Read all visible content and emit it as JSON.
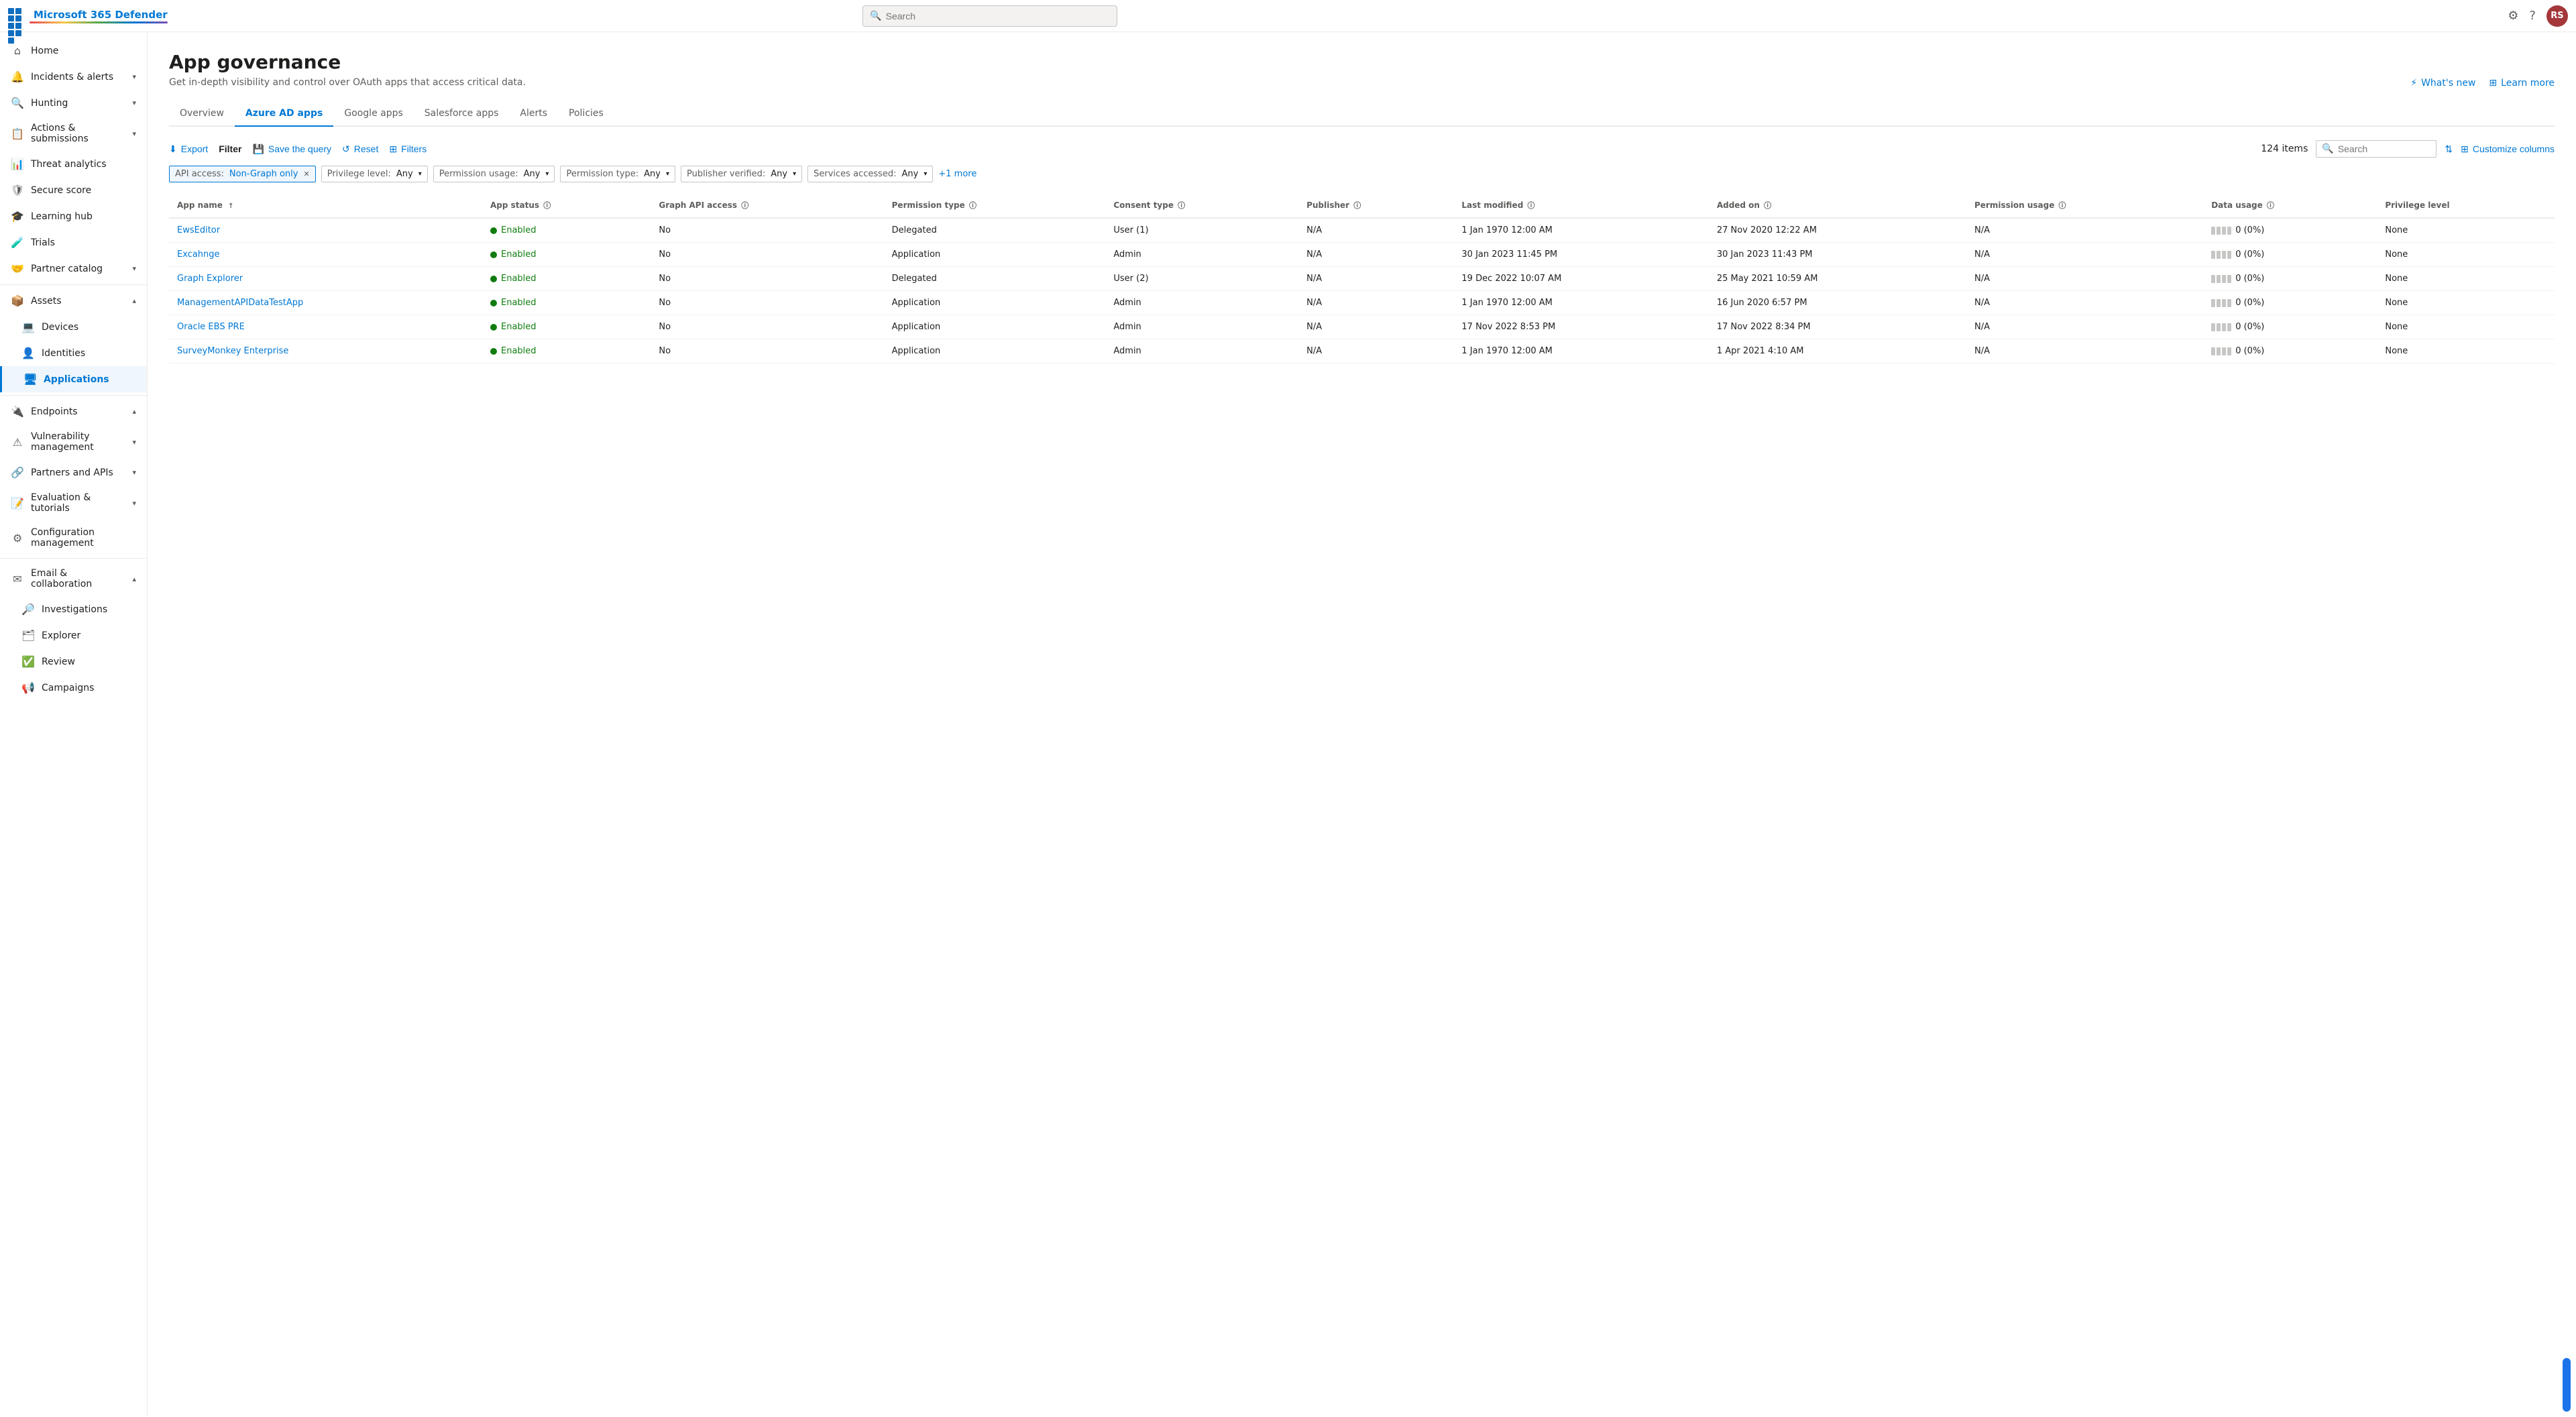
{
  "brand": {
    "name": "Microsoft 365 Defender",
    "search_placeholder": "Search"
  },
  "topbar": {
    "search_placeholder": "Search",
    "avatar_initials": "RS"
  },
  "sidebar": {
    "items": [
      {
        "id": "home",
        "label": "Home",
        "icon": "⌂",
        "has_chevron": false
      },
      {
        "id": "incidents",
        "label": "Incidents & alerts",
        "icon": "🔔",
        "has_chevron": true
      },
      {
        "id": "hunting",
        "label": "Hunting",
        "icon": "🔍",
        "has_chevron": true
      },
      {
        "id": "actions",
        "label": "Actions & submissions",
        "icon": "📋",
        "has_chevron": true
      },
      {
        "id": "threat",
        "label": "Threat analytics",
        "icon": "📊",
        "has_chevron": false
      },
      {
        "id": "secure",
        "label": "Secure score",
        "icon": "🛡",
        "has_chevron": false
      },
      {
        "id": "learning",
        "label": "Learning hub",
        "icon": "🎓",
        "has_chevron": false
      },
      {
        "id": "trials",
        "label": "Trials",
        "icon": "🧪",
        "has_chevron": false
      },
      {
        "id": "partner",
        "label": "Partner catalog",
        "icon": "🤝",
        "has_chevron": true
      },
      {
        "id": "assets",
        "label": "Assets",
        "icon": "📦",
        "has_chevron": true,
        "section": true
      },
      {
        "id": "devices",
        "label": "Devices",
        "icon": "💻",
        "has_chevron": false,
        "indent": true
      },
      {
        "id": "identities",
        "label": "Identities",
        "icon": "👤",
        "has_chevron": false,
        "indent": true
      },
      {
        "id": "applications",
        "label": "Applications",
        "icon": "🖥",
        "has_chevron": false,
        "indent": true,
        "active": true
      },
      {
        "id": "endpoints",
        "label": "Endpoints",
        "icon": "🔌",
        "has_chevron": true
      },
      {
        "id": "vulnerability",
        "label": "Vulnerability management",
        "icon": "⚠",
        "has_chevron": true
      },
      {
        "id": "partners-apis",
        "label": "Partners and APIs",
        "icon": "🔗",
        "has_chevron": true
      },
      {
        "id": "evaluation",
        "label": "Evaluation & tutorials",
        "icon": "📝",
        "has_chevron": true
      },
      {
        "id": "config",
        "label": "Configuration management",
        "icon": "⚙",
        "has_chevron": false
      },
      {
        "id": "email",
        "label": "Email & collaboration",
        "icon": "✉",
        "has_chevron": true,
        "section": true
      },
      {
        "id": "investigations",
        "label": "Investigations",
        "icon": "🔎",
        "has_chevron": false,
        "indent": true
      },
      {
        "id": "explorer",
        "label": "Explorer",
        "icon": "🗂",
        "has_chevron": false,
        "indent": true
      },
      {
        "id": "review",
        "label": "Review",
        "icon": "✅",
        "has_chevron": false,
        "indent": true
      },
      {
        "id": "campaigns",
        "label": "Campaigns",
        "icon": "📢",
        "has_chevron": false,
        "indent": true
      }
    ]
  },
  "page": {
    "title": "App governance",
    "subtitle": "Get in-depth visibility and control over OAuth apps that access critical data.",
    "whats_new": "What's new",
    "learn_more": "Learn more"
  },
  "tabs": [
    {
      "id": "overview",
      "label": "Overview"
    },
    {
      "id": "azure-ad",
      "label": "Azure AD apps",
      "active": true
    },
    {
      "id": "google",
      "label": "Google apps"
    },
    {
      "id": "salesforce",
      "label": "Salesforce apps"
    },
    {
      "id": "alerts",
      "label": "Alerts"
    },
    {
      "id": "policies",
      "label": "Policies"
    }
  ],
  "toolbar": {
    "export_label": "Export",
    "save_query_label": "Save the query",
    "reset_label": "Reset",
    "filters_label": "Filters",
    "items_count": "124 items",
    "search_placeholder": "Search",
    "customize_columns": "Customize columns",
    "filter_label": "Filter"
  },
  "active_filters": [
    {
      "id": "api-access",
      "prefix": "API access:",
      "value": "Non-Graph only",
      "removable": true
    }
  ],
  "filter_dropdowns": [
    {
      "id": "privilege",
      "prefix": "Privilege level:",
      "value": "Any"
    },
    {
      "id": "permission-usage",
      "prefix": "Permission usage:",
      "value": "Any"
    },
    {
      "id": "permission-type",
      "prefix": "Permission type:",
      "value": "Any"
    },
    {
      "id": "publisher-verified",
      "prefix": "Publisher verified:",
      "value": "Any"
    },
    {
      "id": "services-accessed",
      "prefix": "Services accessed:",
      "value": "Any"
    },
    {
      "id": "more",
      "label": "+1 more"
    }
  ],
  "table": {
    "columns": [
      {
        "id": "app-name",
        "label": "App name",
        "sortable": true
      },
      {
        "id": "app-status",
        "label": "App status",
        "info": true
      },
      {
        "id": "graph-api",
        "label": "Graph API access",
        "info": true
      },
      {
        "id": "permission-type",
        "label": "Permission type",
        "info": true
      },
      {
        "id": "consent-type",
        "label": "Consent type",
        "info": true
      },
      {
        "id": "publisher",
        "label": "Publisher",
        "info": true
      },
      {
        "id": "last-modified",
        "label": "Last modified",
        "info": true
      },
      {
        "id": "added-on",
        "label": "Added on",
        "info": true
      },
      {
        "id": "permission-usage",
        "label": "Permission usage",
        "info": true
      },
      {
        "id": "data-usage",
        "label": "Data usage",
        "info": true
      },
      {
        "id": "privilege-level",
        "label": "Privilege level"
      }
    ],
    "rows": [
      {
        "app_name": "EwsEditor",
        "app_status": "Enabled",
        "graph_api": "No",
        "permission_type": "Delegated",
        "consent_type": "User (1)",
        "publisher": "N/A",
        "last_modified": "1 Jan 1970 12:00 AM",
        "added_on": "27 Nov 2020 12:22 AM",
        "permission_usage": "N/A",
        "data_usage": "0 (0%)",
        "privilege_level": "None"
      },
      {
        "app_name": "Excahnge",
        "app_status": "Enabled",
        "graph_api": "No",
        "permission_type": "Application",
        "consent_type": "Admin",
        "publisher": "N/A",
        "last_modified": "30 Jan 2023 11:45 PM",
        "added_on": "30 Jan 2023 11:43 PM",
        "permission_usage": "N/A",
        "data_usage": "0 (0%)",
        "privilege_level": "None"
      },
      {
        "app_name": "Graph Explorer",
        "app_status": "Enabled",
        "graph_api": "No",
        "permission_type": "Delegated",
        "consent_type": "User (2)",
        "publisher": "N/A",
        "last_modified": "19 Dec 2022 10:07 AM",
        "added_on": "25 May 2021 10:59 AM",
        "permission_usage": "N/A",
        "data_usage": "0 (0%)",
        "privilege_level": "None"
      },
      {
        "app_name": "ManagementAPIDataTestApp",
        "app_status": "Enabled",
        "graph_api": "No",
        "permission_type": "Application",
        "consent_type": "Admin",
        "publisher": "N/A",
        "last_modified": "1 Jan 1970 12:00 AM",
        "added_on": "16 Jun 2020 6:57 PM",
        "permission_usage": "N/A",
        "data_usage": "0 (0%)",
        "privilege_level": "None"
      },
      {
        "app_name": "Oracle EBS PRE",
        "app_status": "Enabled",
        "graph_api": "No",
        "permission_type": "Application",
        "consent_type": "Admin",
        "publisher": "N/A",
        "last_modified": "17 Nov 2022 8:53 PM",
        "added_on": "17 Nov 2022 8:34 PM",
        "permission_usage": "N/A",
        "data_usage": "0 (0%)",
        "privilege_level": "None"
      },
      {
        "app_name": "SurveyMonkey Enterprise",
        "app_status": "Enabled",
        "graph_api": "No",
        "permission_type": "Application",
        "consent_type": "Admin",
        "publisher": "N/A",
        "last_modified": "1 Jan 1970 12:00 AM",
        "added_on": "1 Apr 2021 4:10 AM",
        "permission_usage": "N/A",
        "data_usage": "0 (0%)",
        "privilege_level": "None"
      }
    ]
  }
}
